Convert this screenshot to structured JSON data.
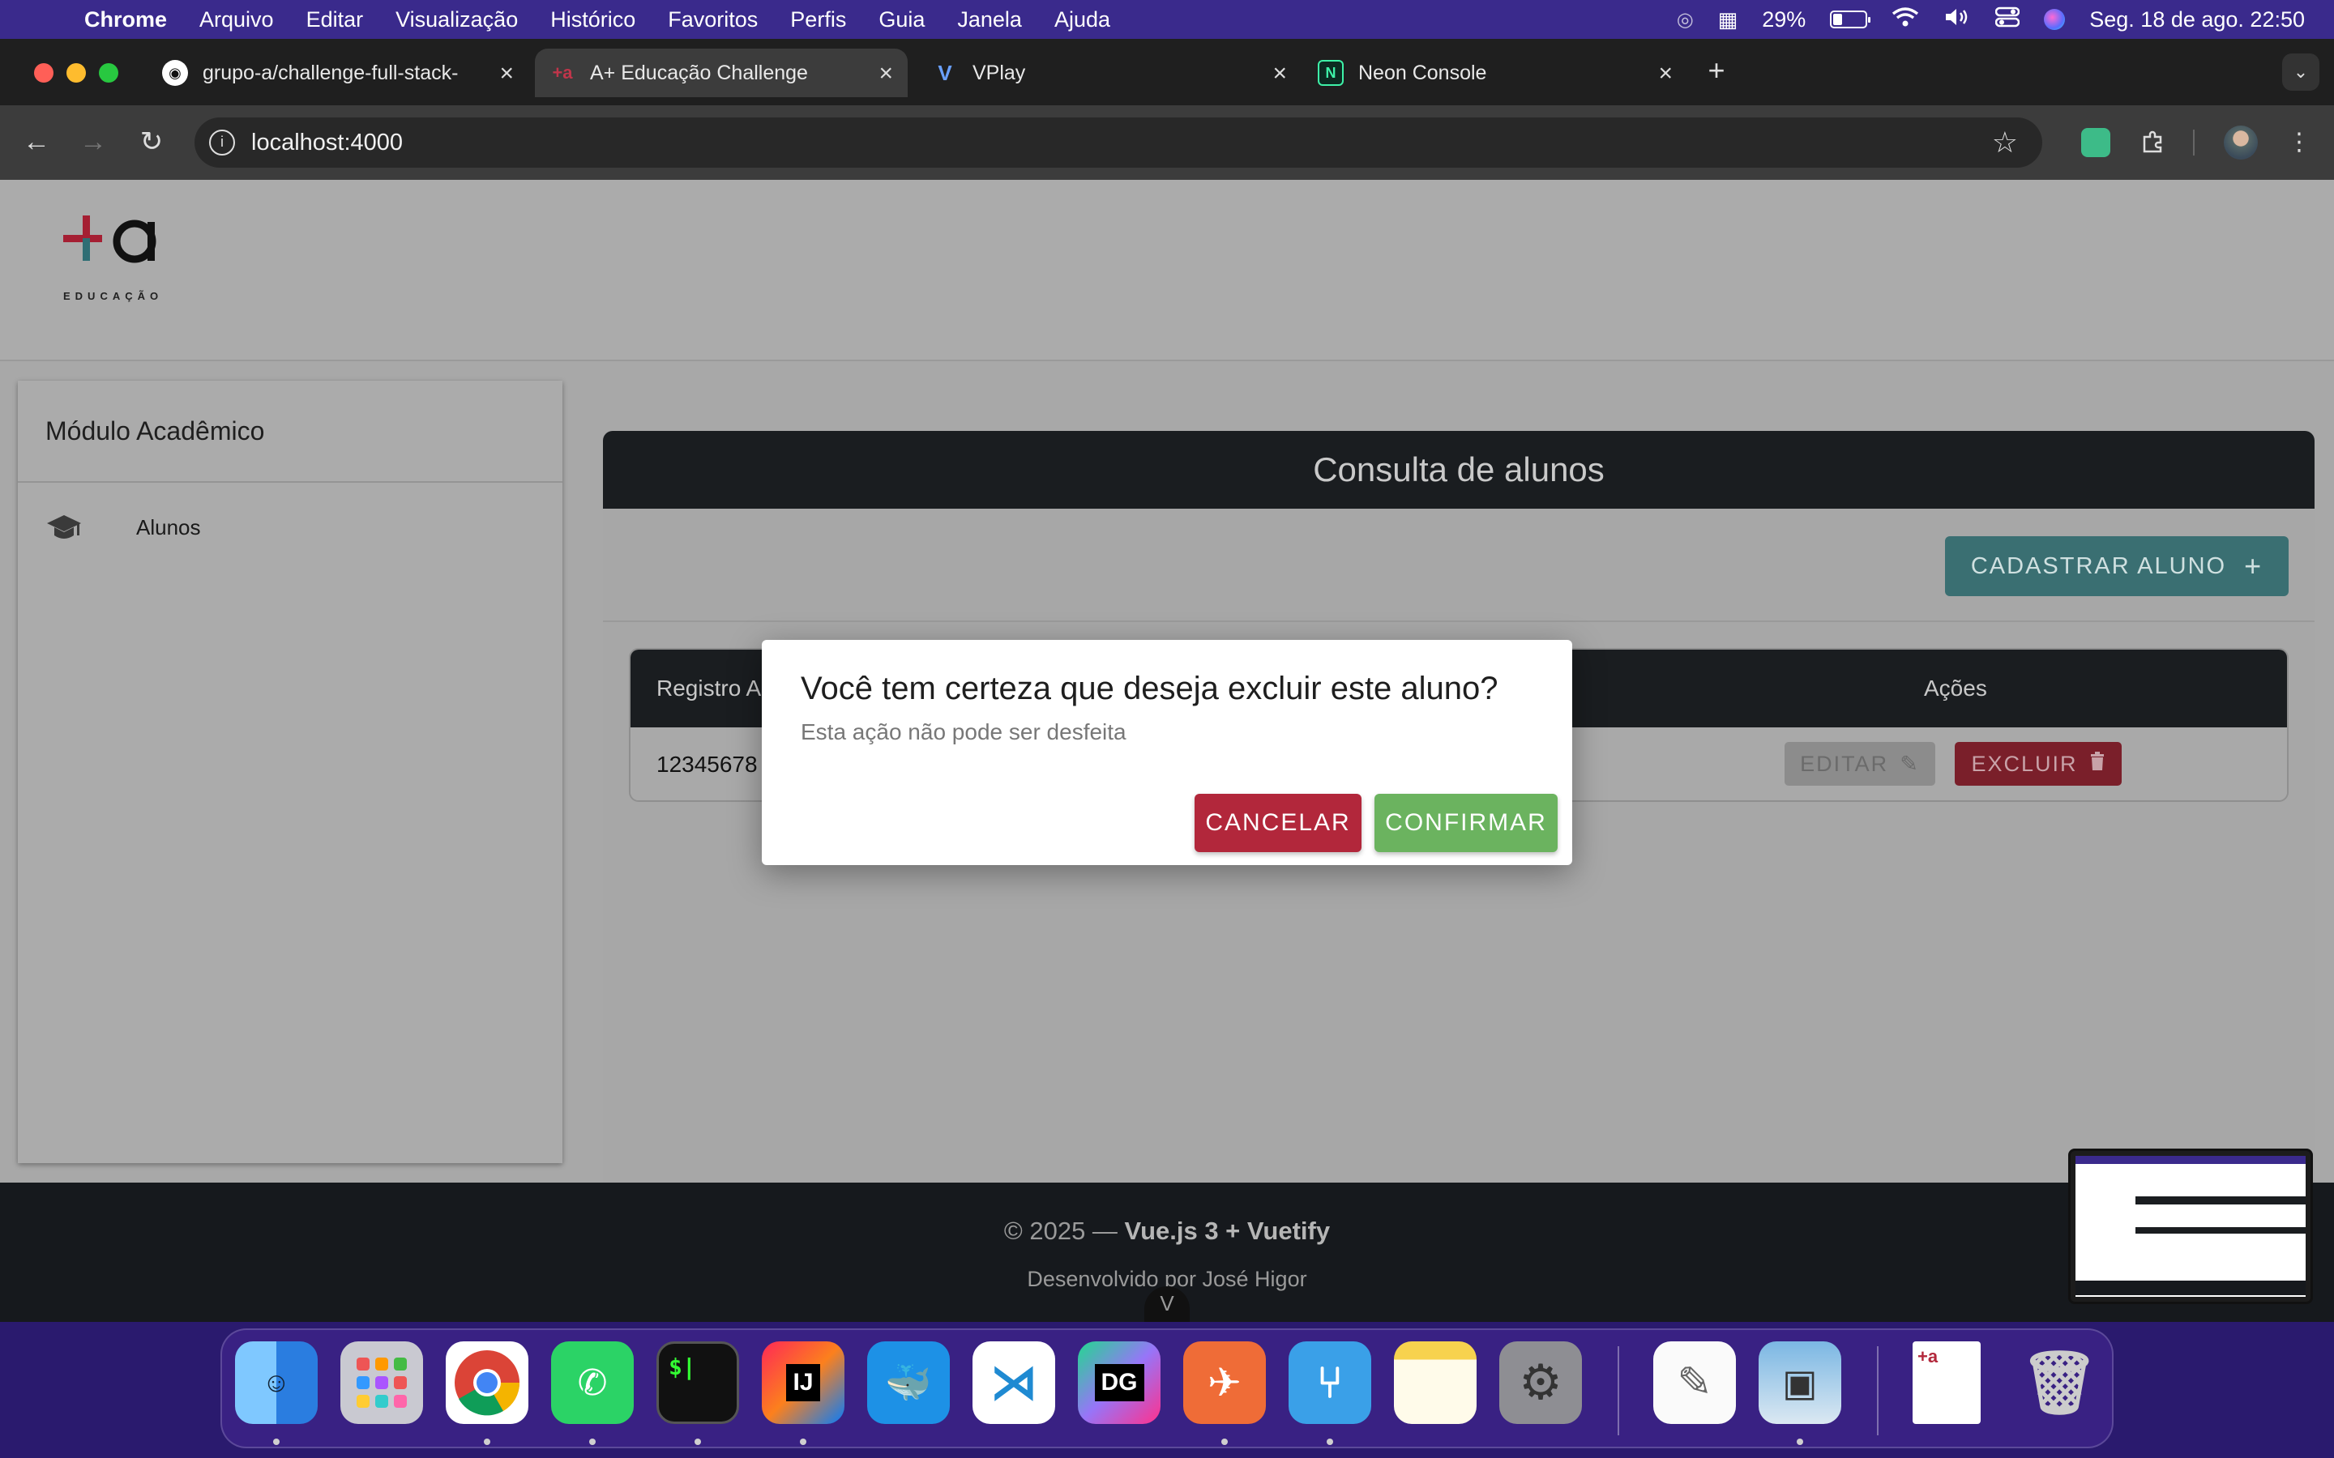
{
  "menubar": {
    "app": "Chrome",
    "items": [
      "Arquivo",
      "Editar",
      "Visualização",
      "Histórico",
      "Favoritos",
      "Perfis",
      "Guia",
      "Janela",
      "Ajuda"
    ],
    "battery": "29%",
    "battery_level": 0.29,
    "datetime": "Seg. 18 de ago.  22:50"
  },
  "browser": {
    "tabs": [
      {
        "title": "grupo-a/challenge-full-stack-",
        "icon": "github-icon"
      },
      {
        "title": "A+ Educação Challenge",
        "icon": "site-favicon"
      },
      {
        "title": "VPlay",
        "icon": "vplay-icon"
      },
      {
        "title": "Neon Console",
        "icon": "neon-icon"
      }
    ],
    "url": "localhost:4000"
  },
  "app": {
    "logo_mark": "+a",
    "logo_sub": "EDUCAÇÃO",
    "sidebar": {
      "title": "Módulo Acadêmico",
      "items": [
        {
          "label": "Alunos",
          "icon": "graduation-cap-icon"
        }
      ]
    },
    "page_title": "Consulta de alunos",
    "add_button": "CADASTRAR ALUNO",
    "table": {
      "columns": [
        "Registro A",
        "Ações"
      ],
      "rows": [
        {
          "registro": "12345678"
        }
      ],
      "edit_label": "EDITAR",
      "delete_label": "EXCLUIR"
    },
    "footer": {
      "copyright": "© 2025 —",
      "stack": "Vue.js 3 + Vuetify",
      "credit": "Desenvolvido por José Higor"
    }
  },
  "dialog": {
    "title": "Você tem certeza que deseja excluir este aluno?",
    "subtitle": "Esta ação não pode ser desfeita",
    "cancel": "CANCELAR",
    "confirm": "CONFIRMAR"
  },
  "colors": {
    "danger": "#b2273b",
    "success": "#6bb35f",
    "teal": "#3a6f72",
    "dark": "#1a1d20"
  },
  "dock": [
    "Finder",
    "Launchpad",
    "Chrome",
    "WhatsApp",
    "Terminal",
    "IntelliJ IDEA",
    "Docker",
    "VS Code",
    "DataGrip",
    "Postman",
    "Fork",
    "Notas",
    "Ajustes do Sistema",
    "TextEdit",
    "Pré-Visualização",
    "Documento",
    "Lixo"
  ]
}
